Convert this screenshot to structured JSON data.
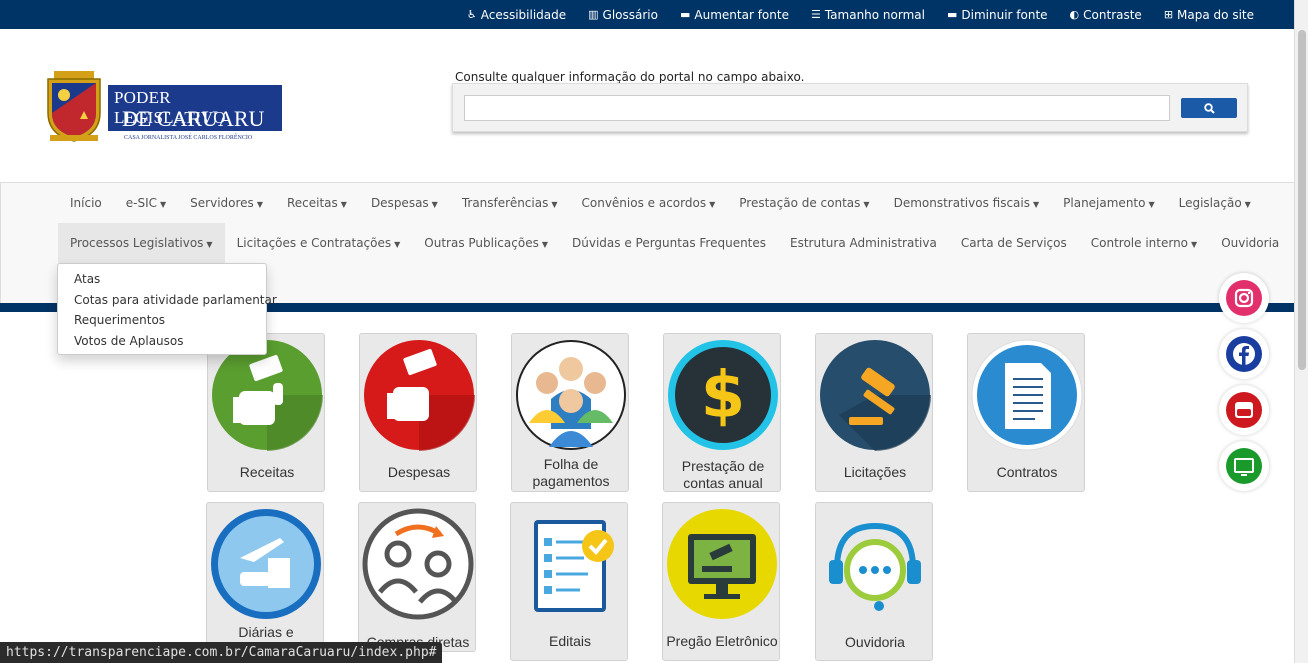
{
  "topbar": {
    "links": [
      {
        "icon": "accessibility-icon",
        "glyph": "♿",
        "label": "Acessibilidade"
      },
      {
        "icon": "book-icon",
        "glyph": "▥",
        "label": "Glossário"
      },
      {
        "icon": "font-increase-icon",
        "glyph": "▬",
        "label": "Aumentar fonte"
      },
      {
        "icon": "list-icon",
        "glyph": "☰",
        "label": "Tamanho normal"
      },
      {
        "icon": "font-decrease-icon",
        "glyph": "▬",
        "label": "Diminuir fonte"
      },
      {
        "icon": "contrast-icon",
        "glyph": "◐",
        "label": "Contraste"
      },
      {
        "icon": "sitemap-icon",
        "glyph": "⊞",
        "label": "Mapa do site"
      }
    ]
  },
  "logo": {
    "line1": "PODER LEGISLATIVO",
    "line2": "DE CARUARU",
    "subtitle": "CASA JORNALISTA JOSÉ CARLOS FLORÊNCIO"
  },
  "search": {
    "hint": "Consulte qualquer informação do portal no campo abaixo.",
    "value": "",
    "button_icon": "search-icon"
  },
  "nav": {
    "row1": [
      {
        "label": "Início",
        "caret": ""
      },
      {
        "label": "e-SIC",
        "caret": "▼"
      },
      {
        "label": "Servidores",
        "caret": "▼"
      },
      {
        "label": "Receitas",
        "caret": "▼"
      },
      {
        "label": "Despesas",
        "caret": "▼"
      },
      {
        "label": "Transferências",
        "caret": "▼"
      },
      {
        "label": "Convênios e acordos",
        "caret": "▼"
      },
      {
        "label": "Prestação de contas",
        "caret": "▼"
      },
      {
        "label": "Demonstrativos fiscais",
        "caret": "▼"
      },
      {
        "label": "Planejamento",
        "caret": "▼"
      },
      {
        "label": "Legislação",
        "caret": "▼"
      }
    ],
    "row2": [
      {
        "label": "Processos Legislativos",
        "caret": "▼"
      },
      {
        "label": "Licitações e Contratações",
        "caret": "▼"
      },
      {
        "label": "Outras Publicações",
        "caret": "▼"
      },
      {
        "label": "Dúvidas e Perguntas Frequentes",
        "caret": ""
      },
      {
        "label": "Estrutura Administrativa",
        "caret": ""
      },
      {
        "label": "Carta de Serviços",
        "caret": ""
      },
      {
        "label": "Controle interno",
        "caret": "▼"
      },
      {
        "label": "Ouvidoria",
        "caret": ""
      }
    ],
    "active": "Processos Legislativos",
    "dropdown": [
      "Atas",
      "Cotas para atividade parlamentar",
      "Requerimentos",
      "Votos de Aplausos"
    ]
  },
  "cards": {
    "row1": [
      {
        "label": "Receitas",
        "icon": "money-hand-green-icon"
      },
      {
        "label": "Despesas",
        "icon": "money-hand-red-icon"
      },
      {
        "label": "Folha de\npagamentos",
        "icon": "people-group-icon"
      },
      {
        "label": "Prestação de\ncontas anual",
        "icon": "dollar-sign-icon"
      },
      {
        "label": "Licitações",
        "icon": "gavel-icon"
      },
      {
        "label": "Contratos",
        "icon": "document-icon"
      }
    ],
    "row2": [
      {
        "label": "Diárias e",
        "icon": "travel-icon"
      },
      {
        "label": "Compras diretas",
        "icon": "users-transfer-icon"
      },
      {
        "label": "Editais",
        "icon": "checklist-icon"
      },
      {
        "label": "Pregão Eletrônico",
        "icon": "auction-monitor-icon"
      },
      {
        "label": "Ouvidoria",
        "icon": "headset-chat-icon"
      }
    ]
  },
  "social": [
    {
      "name": "instagram-icon",
      "color": "#e1306c"
    },
    {
      "name": "facebook-icon",
      "color": "#1a3ea0"
    },
    {
      "name": "youtube-icon",
      "color": "#cc181e"
    },
    {
      "name": "tv-icon",
      "color": "#1a9a2a"
    }
  ],
  "statusbar": {
    "url": "https://transparenciape.com.br/CamaraCaruaru/index.php#"
  }
}
